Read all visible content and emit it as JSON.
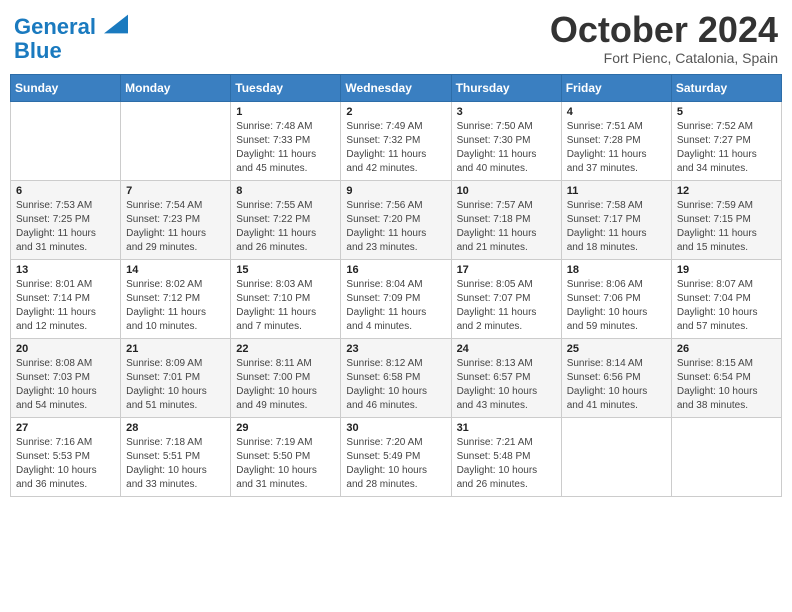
{
  "header": {
    "logo_line1": "General",
    "logo_line2": "Blue",
    "month": "October 2024",
    "location": "Fort Pienc, Catalonia, Spain"
  },
  "days_of_week": [
    "Sunday",
    "Monday",
    "Tuesday",
    "Wednesday",
    "Thursday",
    "Friday",
    "Saturday"
  ],
  "weeks": [
    [
      {
        "day": "",
        "info": ""
      },
      {
        "day": "",
        "info": ""
      },
      {
        "day": "1",
        "info": "Sunrise: 7:48 AM\nSunset: 7:33 PM\nDaylight: 11 hours and 45 minutes."
      },
      {
        "day": "2",
        "info": "Sunrise: 7:49 AM\nSunset: 7:32 PM\nDaylight: 11 hours and 42 minutes."
      },
      {
        "day": "3",
        "info": "Sunrise: 7:50 AM\nSunset: 7:30 PM\nDaylight: 11 hours and 40 minutes."
      },
      {
        "day": "4",
        "info": "Sunrise: 7:51 AM\nSunset: 7:28 PM\nDaylight: 11 hours and 37 minutes."
      },
      {
        "day": "5",
        "info": "Sunrise: 7:52 AM\nSunset: 7:27 PM\nDaylight: 11 hours and 34 minutes."
      }
    ],
    [
      {
        "day": "6",
        "info": "Sunrise: 7:53 AM\nSunset: 7:25 PM\nDaylight: 11 hours and 31 minutes."
      },
      {
        "day": "7",
        "info": "Sunrise: 7:54 AM\nSunset: 7:23 PM\nDaylight: 11 hours and 29 minutes."
      },
      {
        "day": "8",
        "info": "Sunrise: 7:55 AM\nSunset: 7:22 PM\nDaylight: 11 hours and 26 minutes."
      },
      {
        "day": "9",
        "info": "Sunrise: 7:56 AM\nSunset: 7:20 PM\nDaylight: 11 hours and 23 minutes."
      },
      {
        "day": "10",
        "info": "Sunrise: 7:57 AM\nSunset: 7:18 PM\nDaylight: 11 hours and 21 minutes."
      },
      {
        "day": "11",
        "info": "Sunrise: 7:58 AM\nSunset: 7:17 PM\nDaylight: 11 hours and 18 minutes."
      },
      {
        "day": "12",
        "info": "Sunrise: 7:59 AM\nSunset: 7:15 PM\nDaylight: 11 hours and 15 minutes."
      }
    ],
    [
      {
        "day": "13",
        "info": "Sunrise: 8:01 AM\nSunset: 7:14 PM\nDaylight: 11 hours and 12 minutes."
      },
      {
        "day": "14",
        "info": "Sunrise: 8:02 AM\nSunset: 7:12 PM\nDaylight: 11 hours and 10 minutes."
      },
      {
        "day": "15",
        "info": "Sunrise: 8:03 AM\nSunset: 7:10 PM\nDaylight: 11 hours and 7 minutes."
      },
      {
        "day": "16",
        "info": "Sunrise: 8:04 AM\nSunset: 7:09 PM\nDaylight: 11 hours and 4 minutes."
      },
      {
        "day": "17",
        "info": "Sunrise: 8:05 AM\nSunset: 7:07 PM\nDaylight: 11 hours and 2 minutes."
      },
      {
        "day": "18",
        "info": "Sunrise: 8:06 AM\nSunset: 7:06 PM\nDaylight: 10 hours and 59 minutes."
      },
      {
        "day": "19",
        "info": "Sunrise: 8:07 AM\nSunset: 7:04 PM\nDaylight: 10 hours and 57 minutes."
      }
    ],
    [
      {
        "day": "20",
        "info": "Sunrise: 8:08 AM\nSunset: 7:03 PM\nDaylight: 10 hours and 54 minutes."
      },
      {
        "day": "21",
        "info": "Sunrise: 8:09 AM\nSunset: 7:01 PM\nDaylight: 10 hours and 51 minutes."
      },
      {
        "day": "22",
        "info": "Sunrise: 8:11 AM\nSunset: 7:00 PM\nDaylight: 10 hours and 49 minutes."
      },
      {
        "day": "23",
        "info": "Sunrise: 8:12 AM\nSunset: 6:58 PM\nDaylight: 10 hours and 46 minutes."
      },
      {
        "day": "24",
        "info": "Sunrise: 8:13 AM\nSunset: 6:57 PM\nDaylight: 10 hours and 43 minutes."
      },
      {
        "day": "25",
        "info": "Sunrise: 8:14 AM\nSunset: 6:56 PM\nDaylight: 10 hours and 41 minutes."
      },
      {
        "day": "26",
        "info": "Sunrise: 8:15 AM\nSunset: 6:54 PM\nDaylight: 10 hours and 38 minutes."
      }
    ],
    [
      {
        "day": "27",
        "info": "Sunrise: 7:16 AM\nSunset: 5:53 PM\nDaylight: 10 hours and 36 minutes."
      },
      {
        "day": "28",
        "info": "Sunrise: 7:18 AM\nSunset: 5:51 PM\nDaylight: 10 hours and 33 minutes."
      },
      {
        "day": "29",
        "info": "Sunrise: 7:19 AM\nSunset: 5:50 PM\nDaylight: 10 hours and 31 minutes."
      },
      {
        "day": "30",
        "info": "Sunrise: 7:20 AM\nSunset: 5:49 PM\nDaylight: 10 hours and 28 minutes."
      },
      {
        "day": "31",
        "info": "Sunrise: 7:21 AM\nSunset: 5:48 PM\nDaylight: 10 hours and 26 minutes."
      },
      {
        "day": "",
        "info": ""
      },
      {
        "day": "",
        "info": ""
      }
    ]
  ]
}
